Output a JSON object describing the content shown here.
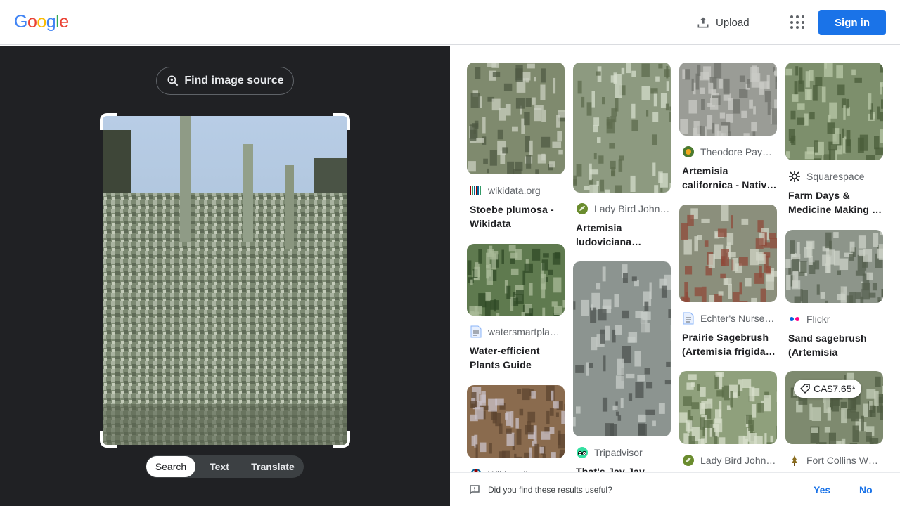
{
  "header": {
    "logo_letters": [
      {
        "ch": "G",
        "color": "#4285F4"
      },
      {
        "ch": "o",
        "color": "#EA4335"
      },
      {
        "ch": "o",
        "color": "#FBBC05"
      },
      {
        "ch": "g",
        "color": "#4285F4"
      },
      {
        "ch": "l",
        "color": "#34A853"
      },
      {
        "ch": "e",
        "color": "#EA4335"
      }
    ],
    "upload_label": "Upload",
    "signin_label": "Sign in"
  },
  "left": {
    "find_source_label": "Find image source",
    "tabs": [
      "Search",
      "Text",
      "Translate"
    ],
    "active_tab": "Search"
  },
  "results": [
    {
      "source": "wikidata.org",
      "source_icon": "wikidata-icon",
      "title": "Stoebe plumosa - Wikidata",
      "palette": [
        "#7f8a6e",
        "#c9cfc0",
        "#4f5a44"
      ]
    },
    {
      "source": "Lady Bird John…",
      "source_icon": "ladybird-icon",
      "title": "Artemisia ludoviciana…",
      "palette": [
        "#8d9a80",
        "#d4dccb",
        "#5d6b4d"
      ]
    },
    {
      "source": "Theodore Pay…",
      "source_icon": "theodore-payne-icon",
      "title": "Artemisia californica - Nativ…",
      "palette": [
        "#9a9c96",
        "#c9cbc5",
        "#6f726b"
      ]
    },
    {
      "source": "Squarespace",
      "source_icon": "squarespace-icon",
      "title": "Farm Days & Medicine Making …",
      "palette": [
        "#7d8f6c",
        "#b9c8a8",
        "#4a5c3a"
      ]
    },
    {
      "source": "watersmartpla…",
      "source_icon": "doc-icon",
      "title": "Water-efficient Plants Guide",
      "palette": [
        "#5f7a4f",
        "#a9bb98",
        "#2f4a25"
      ]
    },
    {
      "source": "Tripadvisor",
      "source_icon": "tripadvisor-icon",
      "title": "That's Jay Jay and…",
      "palette": [
        "#8c9490",
        "#c7ccc8",
        "#4d5350"
      ]
    },
    {
      "source": "Echter's Nurse…",
      "source_icon": "doc-icon",
      "title": "Prairie Sagebrush (Artemisia frigida…",
      "palette": [
        "#8b8f7c",
        "#d0d4c6",
        "#8f4a3a"
      ]
    },
    {
      "source": "Flickr",
      "source_icon": "flickr-icon",
      "title": "Sand sagebrush (Artemisia filifolia…",
      "palette": [
        "#8d958a",
        "#cdd3c8",
        "#56604f"
      ]
    },
    {
      "source": "Wikimedia…",
      "source_icon": "wikimedia-icon",
      "title": "",
      "palette": [
        "#8a6b4e",
        "#c9c2c9",
        "#5c4430"
      ]
    },
    {
      "source": "Lady Bird John…",
      "source_icon": "ladybird-icon",
      "title": "",
      "palette": [
        "#8fa07c",
        "#d8e0cc",
        "#5b6e48"
      ]
    },
    {
      "source": "Fort Collins W…",
      "source_icon": "fortcollins-icon",
      "title": "",
      "price": "CA$7.65*",
      "palette": [
        "#7e8a6f",
        "#c4cdb8",
        "#4f5b41"
      ]
    }
  ],
  "feedback": {
    "question": "Did you find these results useful?",
    "yes": "Yes",
    "no": "No"
  }
}
